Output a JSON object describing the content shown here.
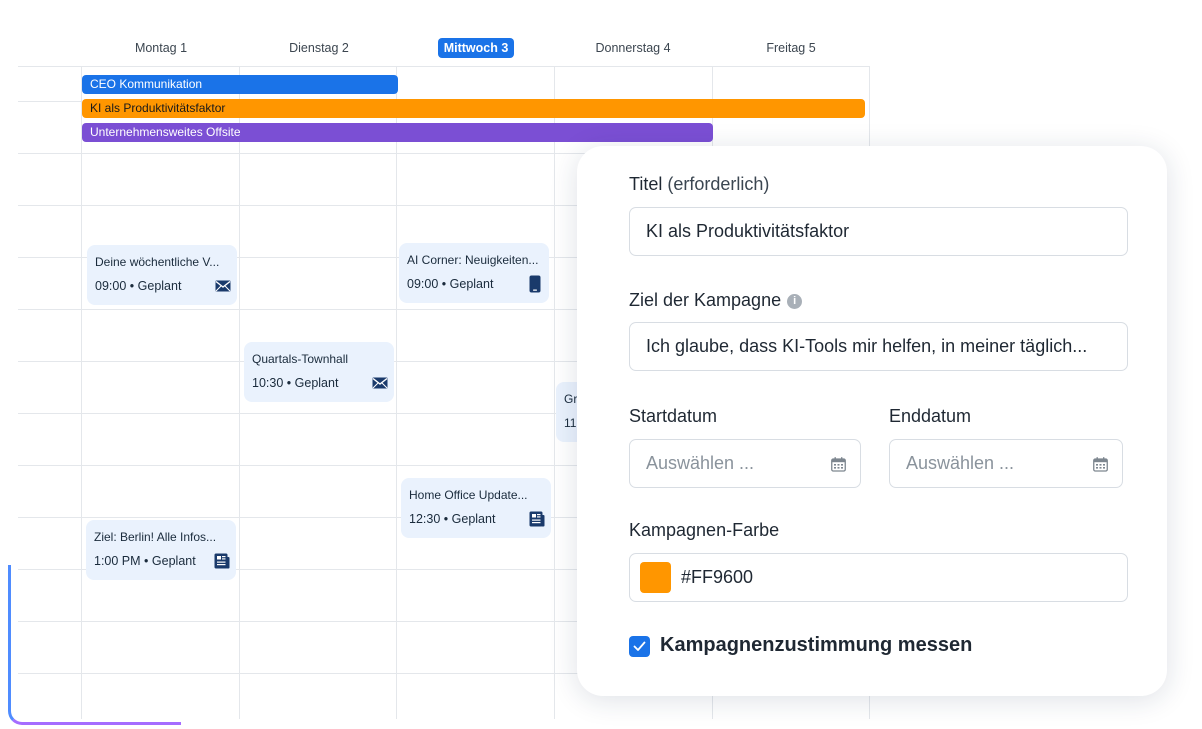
{
  "calendar": {
    "days": [
      {
        "label": "Montag 1",
        "active": false
      },
      {
        "label": "Dienstag 2",
        "active": false
      },
      {
        "label": "Mittwoch 3",
        "active": true
      },
      {
        "label": "Donnerstag 4",
        "active": false
      },
      {
        "label": "Freitag 5",
        "active": false
      }
    ],
    "campaigns": [
      {
        "label": "CEO Kommunikation",
        "color": "#1a73e8",
        "text_color": "#ffffff"
      },
      {
        "label": "KI als Produktivitätsfaktor",
        "color": "#ff9600",
        "text_color": "#1a1a1a"
      },
      {
        "label": "Unternehmensweites Offsite",
        "color": "#7b4fd4",
        "text_color": "#ffffff"
      }
    ],
    "events": [
      {
        "title": "Deine wöchentliche V...",
        "time": "09:00",
        "status": "Geplant",
        "icon": "mail-icon"
      },
      {
        "title": "AI Corner: Neuigkeiten...",
        "time": "09:00",
        "status": "Geplant",
        "icon": "phone-icon"
      },
      {
        "title": "Quartals-Townhall",
        "time": "10:30",
        "status": "Geplant",
        "icon": "mail-icon"
      },
      {
        "title": "Gr",
        "time": "11",
        "status": "",
        "icon": ""
      },
      {
        "title": "Home Office Update...",
        "time": "12:30",
        "status": "Geplant",
        "icon": "news-icon"
      },
      {
        "title": "Ziel: Berlin! Alle Infos...",
        "time": "1:00 PM",
        "status": "Geplant",
        "icon": "news-icon"
      }
    ],
    "separator": "•"
  },
  "form": {
    "title_label": "Titel",
    "title_required": "(erforderlich)",
    "title_value": "KI als Produktivitätsfaktor",
    "goal_label": "Ziel der Kampagne",
    "goal_value": "Ich glaube, dass KI-Tools mir helfen, in meiner täglich...",
    "start_label": "Startdatum",
    "start_placeholder": "Auswählen ...",
    "end_label": "Enddatum",
    "end_placeholder": "Auswählen ...",
    "color_label": "Kampagnen-Farbe",
    "color_value": "#FF9600",
    "consent_label": "Kampagnenzustimmung messen",
    "consent_checked": true
  },
  "colors": {
    "accent": "#1a73e8",
    "campaign": "#FF9600"
  }
}
